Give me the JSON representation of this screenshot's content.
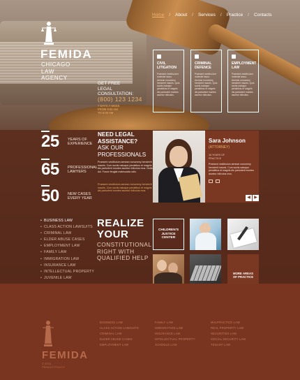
{
  "nav": {
    "items": [
      "Home",
      "About",
      "Services",
      "Practice",
      "Contacts"
    ],
    "active": 0
  },
  "logo": {
    "name": "FEMIDA",
    "tagline_lines": [
      "CHICAGO",
      "LAW",
      "AGENCY"
    ]
  },
  "consultation": {
    "label_lines": [
      "GET FREE",
      "LEGAL",
      "CONSULTATION:"
    ],
    "phone": "(800) 123 1234",
    "hours_lines": [
      "7 DAYS A WEEK",
      "FROM 8:00 AM",
      "TO 6:00 AM"
    ]
  },
  "practice_cards": [
    {
      "icon": "gavel-icon",
      "title_lines": [
        "CIVIL",
        "LITIGATION"
      ],
      "text": "Praesent vestibu-lum molestie lacus. Aenean nonummy hendrerit mauris. Quis sociis natoque penatibus et magnis dis parturient montes ascetur ridiculus."
    },
    {
      "icon": "lock-icon",
      "title_lines": [
        "CRIMINAL",
        "DEFENCE"
      ],
      "text": "Praesent vestibu-lum molestie lacus. Aenean nonummy hendrerit mauris. Quis sociis natoque penatibus et magnis dis parturient montes ascetur ridiculus."
    },
    {
      "icon": "briefcase-icon",
      "title_lines": [
        "EMPLOYMENT",
        "LAW"
      ],
      "text": "Praesent vestibu-lum molestie lacus. Aenean nonummy hendrerit mauris. Quis sociis natoque penatibus et magnis dis parturient montes ascetur ridiculus."
    }
  ],
  "stats": [
    {
      "number": "25",
      "label_lines": [
        "YEARS OF",
        "EXPERIENCE"
      ]
    },
    {
      "number": "65",
      "label_lines": [
        "PROFESSIONAL",
        "LAWYERS"
      ]
    },
    {
      "number": "50",
      "label_lines": [
        "NEW CASES",
        "EVERY YEAR"
      ]
    }
  ],
  "help": {
    "title_lines": [
      "NEED LEGAL",
      "ASSISTANCE?"
    ],
    "sub_lines": [
      "ASK OUR",
      "PROFESSIONALS"
    ],
    "text1": "Praesent vestibulum aenean nonummy hendrerit mauris. Cum sociis natoque penatibus et magnis dis parturient montes ascetur ridiculus mus. Nulla dui. Fusce feugiat malesuada odio.",
    "text2": "Praesent vestibulum aenean nonummy hendrerit mauris. Cum sociis natoque penatibus et magnis dis parturient montes ascetur ridiculus mus."
  },
  "lawyer": {
    "name": "Sara Johnson",
    "role": "(ATTORNEY)",
    "experience_lines": [
      "18 YEARS OF",
      "PRACTICE"
    ],
    "bio": "Praesent vestibulum aenean nonummy hendrerit mauris. Cum sociis natoque penatibus et magnis dis parturient montes ascetur ridiculus mus.",
    "prev_arrow": "◀",
    "next_arrow": "▶"
  },
  "practice_list": {
    "items": [
      "BUSINESS LAW",
      "CLASS ACTION LAWSUITS",
      "CRIMINAL LAW",
      "ELDER ABUSE CASES",
      "EMPLOYMENT LAW",
      "FAMILY LAW",
      "IMMIGRATION LAW",
      "INSURANCE LAW",
      "INTELLECTUAL PROPERTY",
      "JUVENILE LAW"
    ],
    "active": 0
  },
  "realize": {
    "title_lines": [
      "REALIZE",
      "YOUR"
    ],
    "sub_lines": [
      "CONSTITUTIONAL",
      "RIGHT WITH",
      "QUALIFIED HELP"
    ]
  },
  "tiles": {
    "center_lines": [
      "CHILDREN'S",
      "JUSTICE",
      "CENTER"
    ],
    "more_lines": [
      "MORE AREAS",
      "OF PRACTICE"
    ]
  },
  "footer": {
    "logo_name": "FEMIDA",
    "copyright_lines": [
      "© 2015",
      "PRIVACY POLICY"
    ],
    "col1": [
      "BUSINESS LAW",
      "CLASS ACTION LAWSUITS",
      "CRIMINAL LAW",
      "ELDER ABUSE CASES",
      "EMPLOYMENT LAW"
    ],
    "col2": [
      "FAMILY LAW",
      "IMMIGRATION LAW",
      "INSURANCE LAW",
      "INTELLECTUAL PROPERTY",
      "JUVENILE LAW"
    ],
    "col3": [
      "MALPRACTICE LAW",
      "REAL PROPERTY LAW",
      "SECURITIES LAW",
      "SOCIAL SECURITY LAW",
      "TENANT LAW"
    ]
  },
  "colors": {
    "accent": "#f0b36a",
    "brand_dark": "#5a2a1c",
    "brand_mid": "#7a3722"
  }
}
